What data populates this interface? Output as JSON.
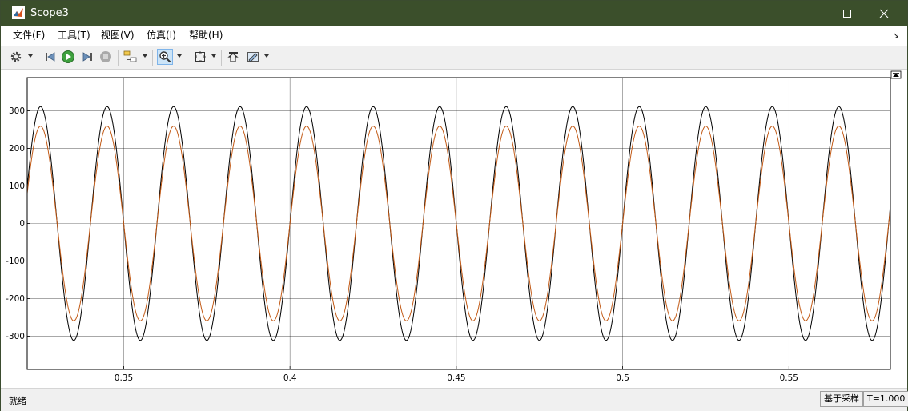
{
  "window": {
    "title": "Scope3",
    "icon": "matlab-scope-icon",
    "controls": [
      "minimize-icon",
      "maximize-icon",
      "close-icon"
    ]
  },
  "menu": {
    "items": [
      {
        "label": "文件(F)"
      },
      {
        "label": "工具(T)"
      },
      {
        "label": "视图(V)"
      },
      {
        "label": "仿真(I)"
      },
      {
        "label": "帮助(H)"
      }
    ],
    "corner_glyph": "↘"
  },
  "toolbar": {
    "buttons": [
      "settings-gear-icon",
      "step-back-icon",
      "run-icon",
      "step-forward-icon",
      "stop-icon",
      "highlight-block-icon",
      "zoom-in-icon",
      "fit-to-view-icon",
      "axes-scaling-icon",
      "style-icon"
    ],
    "active": "zoom-in-icon"
  },
  "status": {
    "left_text": "就绪",
    "sample_mode": "基于采样",
    "time_readout": "T=1.000"
  },
  "colors": {
    "title_bar": "#3b4f2b",
    "series_1": "#000000",
    "series_2": "#c25a16",
    "grid": "#000000"
  },
  "chart_data": {
    "type": "line",
    "title": "",
    "xlabel": "",
    "ylabel": "",
    "xlim": [
      0.321,
      0.5805
    ],
    "ylim": [
      -388,
      388
    ],
    "x_ticks": [
      0.35,
      0.4,
      0.45,
      0.5,
      0.55
    ],
    "x_tick_labels": [
      "0.35",
      "0.4",
      "0.45",
      "0.5",
      "0.55"
    ],
    "y_ticks": [
      300,
      200,
      100,
      0,
      -100,
      -200,
      -300
    ],
    "y_tick_labels": [
      "300",
      "200",
      "100",
      "0",
      "-100",
      "-200",
      "-300"
    ],
    "grid": true,
    "series": [
      {
        "color": "#000000",
        "waveform": "sine",
        "amplitude": 311,
        "frequency_hz": 50,
        "phase_deg": 0
      },
      {
        "color": "#c25a16",
        "waveform": "sine",
        "amplitude": 259,
        "frequency_hz": 50,
        "phase_deg": 0
      }
    ]
  }
}
